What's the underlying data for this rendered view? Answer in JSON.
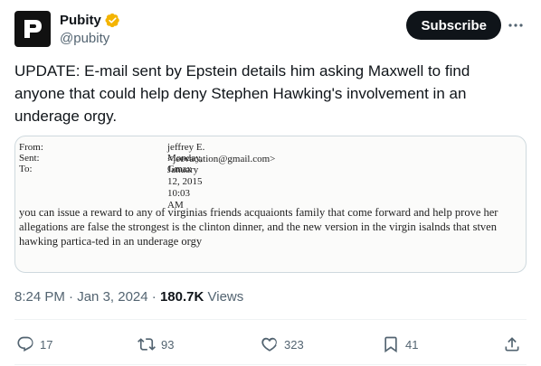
{
  "author": {
    "display_name": "Pubity",
    "handle": "@pubity",
    "verified": true,
    "avatar_icon": "pubity-p-logo",
    "badge_color": "#f4b400"
  },
  "header": {
    "subscribe_label": "Subscribe",
    "more_icon": "ellipsis-icon"
  },
  "tweet": {
    "text": "UPDATE: E-mail sent by Epstein details him asking Maxwell to find anyone that could help deny Stephen Hawking's involvement in an underage orgy."
  },
  "email_image": {
    "headers": [
      {
        "label": "From:",
        "value": "jeffrey E. <jeevacation@gmail.com>"
      },
      {
        "label": "Sent:",
        "value": "Monday, January 12, 2015 10:03 AM"
      },
      {
        "label": "To:",
        "value": "Gmax"
      }
    ],
    "body_lines": [
      "you can issue a reward to any of virginias  friends acquaionts  family that come forward  and help prove her",
      "allegations are false  the strongest is the clinton dinner,  and the new version in the virgin isalnds  that stven",
      "hawking partica-ted in an underage orgy"
    ]
  },
  "meta": {
    "time": "8:24 PM",
    "separator": "·",
    "date": "Jan 3, 2024",
    "views_count": "180.7K",
    "views_label": "Views"
  },
  "actions": {
    "replies": "17",
    "reposts": "93",
    "likes": "323",
    "bookmarks": "41"
  },
  "colors": {
    "text_primary": "#0f1419",
    "text_secondary": "#536471",
    "border": "#cfd9de",
    "button_bg": "#0f1419"
  }
}
